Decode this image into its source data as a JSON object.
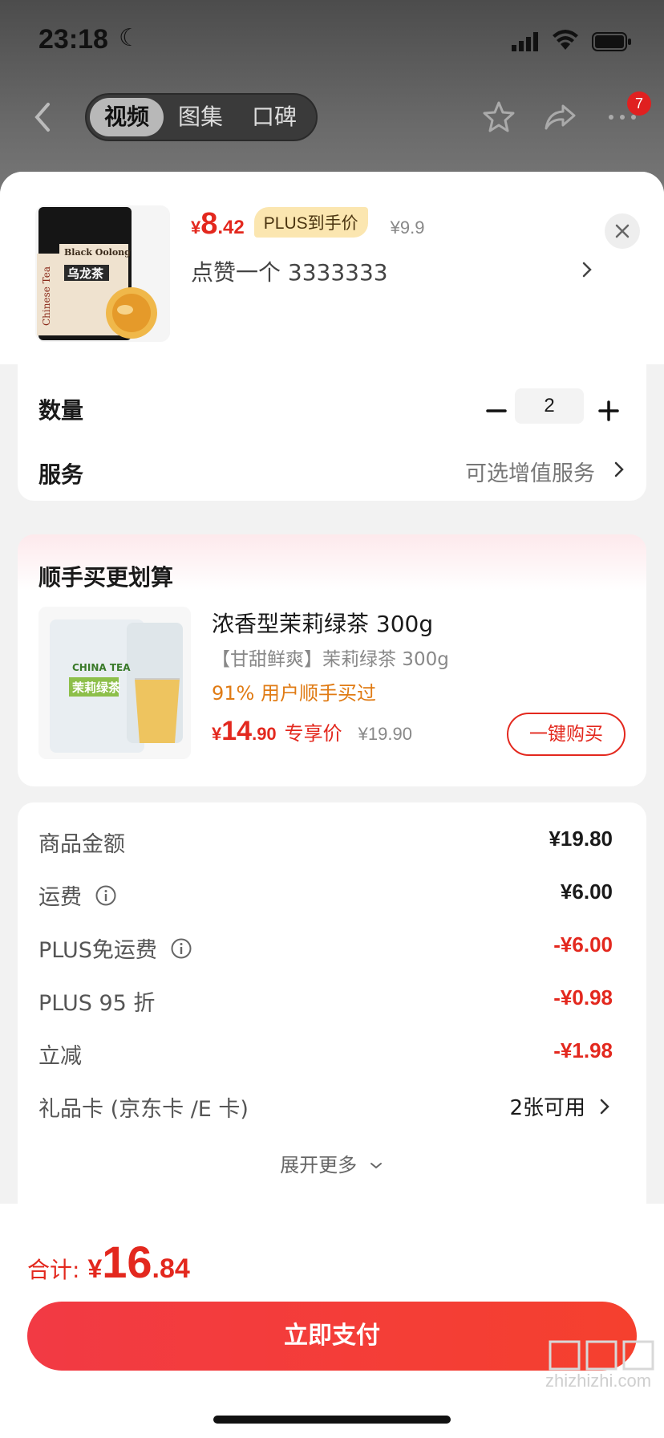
{
  "status_bar": {
    "time": "23:18"
  },
  "nav": {
    "tabs": [
      {
        "label": "视频",
        "active": true
      },
      {
        "label": "图集",
        "active": false
      },
      {
        "label": "口碑",
        "active": false
      }
    ],
    "more_badge": "7"
  },
  "product": {
    "thumb_label": "Black Oolong",
    "thumb_side": "Chinese Tea",
    "thumb_name": "乌龙茶",
    "price_symbol": "¥",
    "price_int": "8",
    "price_dec": ".42",
    "plus_badge": "PLUS到手价",
    "original_price": "¥9.9",
    "variant": "点赞一个  3333333"
  },
  "quantity": {
    "label": "数量",
    "value": "2"
  },
  "service": {
    "label": "服务",
    "value": "可选增值服务"
  },
  "bundle": {
    "title": "顺手买更划算",
    "thumb_text": "茉莉绿茶",
    "thumb_top": "CHINA TEA",
    "name": "浓香型茉莉绿茶 300g",
    "subtitle": "【甘甜鲜爽】茉莉绿茶 300g",
    "stat": "91% 用户顺手买过",
    "price_symbol": "¥",
    "price_int": "14",
    "price_dec": ".90",
    "price_label": "专享价",
    "original_price": "¥19.90",
    "buy_label": "一键购买"
  },
  "fees": [
    {
      "label": "商品金额",
      "value": "¥19.80",
      "red": false,
      "info": false
    },
    {
      "label": "运费",
      "value": "¥6.00",
      "red": false,
      "info": true
    },
    {
      "label": "PLUS免运费",
      "value": "-¥6.00",
      "red": true,
      "info": true
    },
    {
      "label": "PLUS 95 折",
      "value": "-¥0.98",
      "red": true,
      "info": false
    },
    {
      "label": "立减",
      "value": "-¥1.98",
      "red": true,
      "info": false
    }
  ],
  "gift_card": {
    "label": "礼品卡 (京东卡 /E 卡)",
    "value": "2张可用"
  },
  "expand_more": "展开更多",
  "total": {
    "label": "合计:",
    "symbol": "¥",
    "int": "16",
    "dec": ".84"
  },
  "pay_button": "立即支付",
  "watermark": "zhizhizhi.com",
  "colors": {
    "accent": "#e3281e",
    "pay_gradient_start": "#f23a44",
    "pay_gradient_end": "#f5402e",
    "plus_badge_bg": "#fbe6b0"
  }
}
